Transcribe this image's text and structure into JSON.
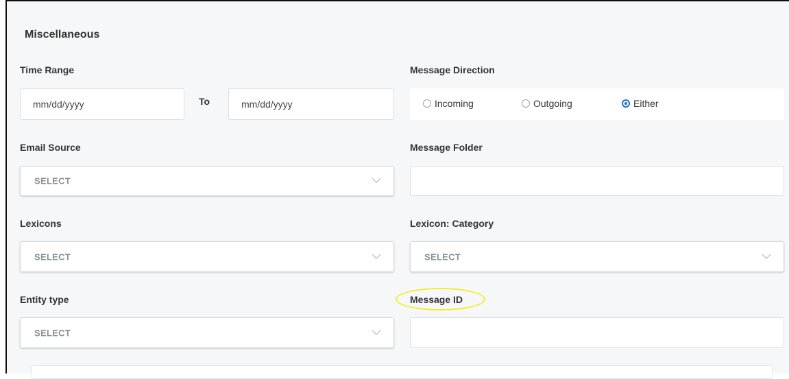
{
  "section": {
    "title": "Miscellaneous"
  },
  "time_range": {
    "label": "Time Range",
    "from_placeholder": "mm/dd/yyyy",
    "to_label": "To",
    "to_placeholder": "mm/dd/yyyy"
  },
  "message_direction": {
    "label": "Message Direction",
    "options": [
      {
        "label": "Incoming",
        "checked": false
      },
      {
        "label": "Outgoing",
        "checked": false
      },
      {
        "label": "Either",
        "checked": true
      }
    ],
    "accent_color": "#1a73c8"
  },
  "email_source": {
    "label": "Email Source",
    "value": "SELECT"
  },
  "message_folder": {
    "label": "Message Folder",
    "value": ""
  },
  "lexicons": {
    "label": "Lexicons",
    "value": "SELECT"
  },
  "lexicon_category": {
    "label": "Lexicon: Category",
    "value": "SELECT"
  },
  "entity_type": {
    "label": "Entity type",
    "value": "SELECT"
  },
  "message_id": {
    "label": "Message ID",
    "value": "",
    "highlight_color": "#f0ee2a"
  },
  "icons": {
    "dropdown": "chevron-down-icon",
    "radio": "radio-icon"
  }
}
